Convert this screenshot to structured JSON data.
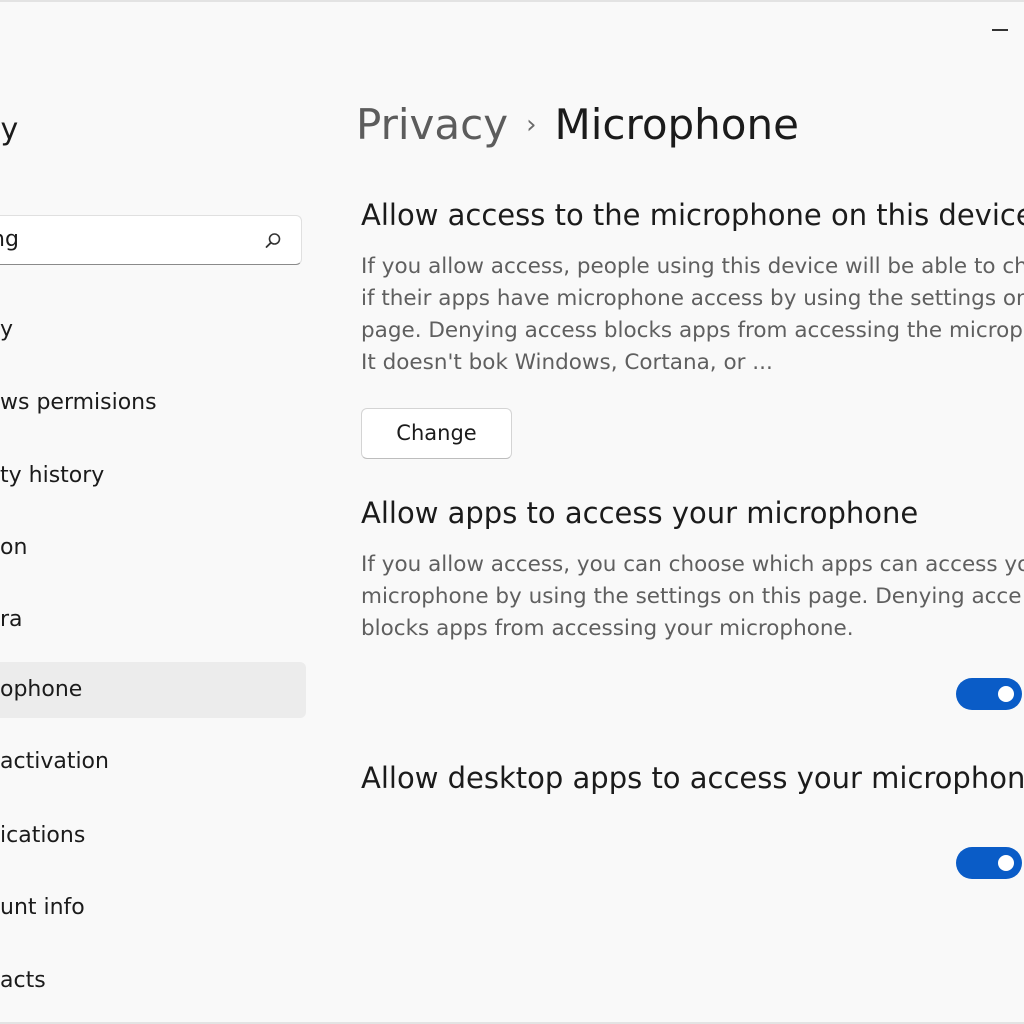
{
  "window": {
    "minimize_label": "Minimize"
  },
  "sidebar": {
    "title": "ey",
    "search": {
      "value": "ng",
      "placeholder": ""
    },
    "items": [
      {
        "label": "y",
        "active": false
      },
      {
        "label": "ws permisions",
        "active": false
      },
      {
        "label": "ty history",
        "active": false
      },
      {
        "label": "on",
        "active": false
      },
      {
        "label": "ra",
        "active": false
      },
      {
        "label": "ophone",
        "active": true
      },
      {
        "label": "activation",
        "active": false
      },
      {
        "label": "ications",
        "active": false
      },
      {
        "label": "unt info",
        "active": false
      },
      {
        "label": "acts",
        "active": false
      }
    ]
  },
  "breadcrumb": {
    "parent": "Privacy",
    "separator": "›",
    "current": "Microphone"
  },
  "sections": [
    {
      "title": "Allow access to the microphone on this device",
      "description_lines": [
        "If you allow access, people using this device will be able to ch",
        "if their apps have microphone access by using the settings on",
        "page. Denying access blocks apps from accessing the microp",
        "It doesn't bok Windows, Cortana, or ..."
      ],
      "button_label": "Change"
    },
    {
      "title": "Allow apps to access your microphone",
      "description_lines": [
        "If you allow access, you can choose which apps can access yo",
        "microphone by using the settings on this page. Denying acce",
        "blocks apps from accessing your microphone."
      ],
      "toggle_on": true
    },
    {
      "title": "Allow desktop apps to access your microphone",
      "toggle_on": true
    }
  ],
  "colors": {
    "accent": "#0a5cc7",
    "background": "#f9f9f9",
    "active_nav": "#ececec"
  }
}
